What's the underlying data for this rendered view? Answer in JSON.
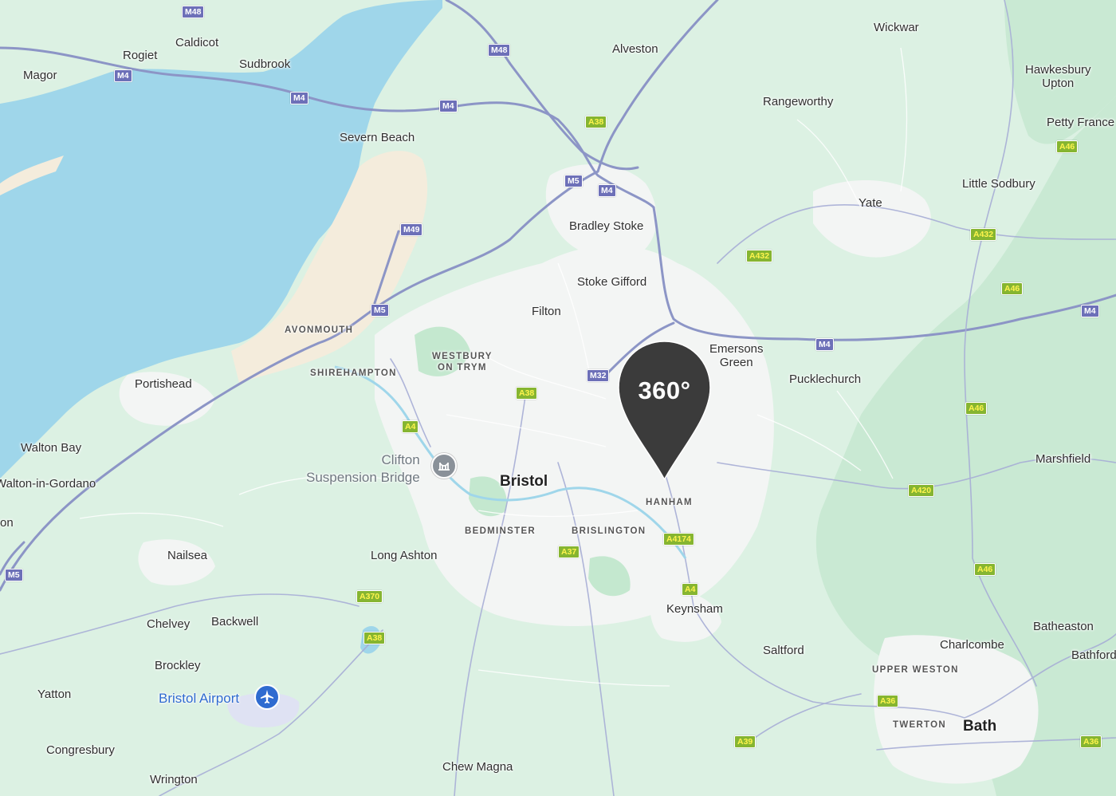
{
  "map": {
    "pin_label": "360°",
    "colors": {
      "water": "#9fd6ea",
      "land": "#dcf1e3",
      "urban": "#f3f5f4",
      "park": "#c4e8cf",
      "motorway": "#8c95c6",
      "road": "#ffffff",
      "pin": "#3b3b3b",
      "beach": "#f4ecdc"
    },
    "places": [
      {
        "id": "magor",
        "text": "Magor"
      },
      {
        "id": "rogiet",
        "text": "Rogiet"
      },
      {
        "id": "caldicot",
        "text": "Caldicot"
      },
      {
        "id": "sudbrook",
        "text": "Sudbrook"
      },
      {
        "id": "alveston",
        "text": "Alveston"
      },
      {
        "id": "wickwar",
        "text": "Wickwar"
      },
      {
        "id": "hawkesbury",
        "text": "Hawkesbury\nUpton"
      },
      {
        "id": "rangeworthy",
        "text": "Rangeworthy"
      },
      {
        "id": "petty-france",
        "text": "Petty France"
      },
      {
        "id": "severn-beach",
        "text": "Severn Beach"
      },
      {
        "id": "little-sodbury",
        "text": "Little Sodbury"
      },
      {
        "id": "yate",
        "text": "Yate"
      },
      {
        "id": "bradley-stoke",
        "text": "Bradley Stoke"
      },
      {
        "id": "stoke-gifford",
        "text": "Stoke Gifford"
      },
      {
        "id": "filton",
        "text": "Filton"
      },
      {
        "id": "emersons-green",
        "text": "Emersons\nGreen"
      },
      {
        "id": "pucklechurch",
        "text": "Pucklechurch"
      },
      {
        "id": "portishead",
        "text": "Portishead"
      },
      {
        "id": "walton-bay",
        "text": "Walton Bay"
      },
      {
        "id": "walton-in-gordano",
        "text": "Walton-in-Gordano"
      },
      {
        "id": "on",
        "text": "on"
      },
      {
        "id": "marshfield",
        "text": "Marshfield"
      },
      {
        "id": "bristol",
        "text": "Bristol"
      },
      {
        "id": "nailsea",
        "text": "Nailsea"
      },
      {
        "id": "long-ashton",
        "text": "Long Ashton"
      },
      {
        "id": "chelvey",
        "text": "Chelvey"
      },
      {
        "id": "backwell",
        "text": "Backwell"
      },
      {
        "id": "keynsham",
        "text": "Keynsham"
      },
      {
        "id": "saltford",
        "text": "Saltford"
      },
      {
        "id": "batheaston",
        "text": "Batheaston"
      },
      {
        "id": "charlcombe",
        "text": "Charlcombe"
      },
      {
        "id": "bathford",
        "text": "Bathford"
      },
      {
        "id": "brockley",
        "text": "Brockley"
      },
      {
        "id": "yatton",
        "text": "Yatton"
      },
      {
        "id": "bath",
        "text": "Bath"
      },
      {
        "id": "congresbury",
        "text": "Congresbury"
      },
      {
        "id": "wrington",
        "text": "Wrington"
      },
      {
        "id": "chew-magna",
        "text": "Chew Magna"
      }
    ],
    "districts": [
      {
        "id": "avonmouth",
        "text": "AVONMOUTH"
      },
      {
        "id": "shirehampton",
        "text": "SHIREHAMPTON"
      },
      {
        "id": "westbury",
        "text": "WESTBURY\nON TRYM"
      },
      {
        "id": "hanham",
        "text": "HANHAM"
      },
      {
        "id": "bedminster",
        "text": "BEDMINSTER"
      },
      {
        "id": "brislington",
        "text": "BRISLINGTON"
      },
      {
        "id": "upper-weston",
        "text": "UPPER WESTON"
      },
      {
        "id": "twerton",
        "text": "TWERTON"
      }
    ],
    "pois": [
      {
        "id": "clifton-bridge",
        "text": "Clifton\nSuspension Bridge",
        "icon": "bridge-icon"
      },
      {
        "id": "bristol-airport",
        "text": "Bristol Airport",
        "icon": "airplane-icon"
      }
    ],
    "shields": [
      {
        "id": "m48-a",
        "text": "M48",
        "type": "m"
      },
      {
        "id": "m48-b",
        "text": "M48",
        "type": "m"
      },
      {
        "id": "m4-a",
        "text": "M4",
        "type": "m"
      },
      {
        "id": "m4-b",
        "text": "M4",
        "type": "m"
      },
      {
        "id": "m4-c",
        "text": "M4",
        "type": "m"
      },
      {
        "id": "m4-d",
        "text": "M4",
        "type": "m"
      },
      {
        "id": "m4-e",
        "text": "M4",
        "type": "m"
      },
      {
        "id": "m4-f",
        "text": "M4",
        "type": "m"
      },
      {
        "id": "m5-a",
        "text": "M5",
        "type": "m"
      },
      {
        "id": "m5-b",
        "text": "M5",
        "type": "m"
      },
      {
        "id": "m5-c",
        "text": "M5",
        "type": "m"
      },
      {
        "id": "m49",
        "text": "M49",
        "type": "m"
      },
      {
        "id": "m32",
        "text": "M32",
        "type": "m"
      },
      {
        "id": "a38-a",
        "text": "A38",
        "type": "a"
      },
      {
        "id": "a38-b",
        "text": "A38",
        "type": "a"
      },
      {
        "id": "a38-c",
        "text": "A38",
        "type": "a"
      },
      {
        "id": "a432-a",
        "text": "A432",
        "type": "a"
      },
      {
        "id": "a432-b",
        "text": "A432",
        "type": "a"
      },
      {
        "id": "a46-a",
        "text": "A46",
        "type": "a"
      },
      {
        "id": "a46-b",
        "text": "A46",
        "type": "a"
      },
      {
        "id": "a46-c",
        "text": "A46",
        "type": "a"
      },
      {
        "id": "a46-d",
        "text": "A46",
        "type": "a"
      },
      {
        "id": "a4-a",
        "text": "A4",
        "type": "a"
      },
      {
        "id": "a4-b",
        "text": "A4",
        "type": "a"
      },
      {
        "id": "a420",
        "text": "A420",
        "type": "a"
      },
      {
        "id": "a4174",
        "text": "A4174",
        "type": "a"
      },
      {
        "id": "a37",
        "text": "A37",
        "type": "a"
      },
      {
        "id": "a370",
        "text": "A370",
        "type": "a"
      },
      {
        "id": "a36-a",
        "text": "A36",
        "type": "a"
      },
      {
        "id": "a36-b",
        "text": "A36",
        "type": "a"
      },
      {
        "id": "a39",
        "text": "A39",
        "type": "a"
      }
    ]
  }
}
